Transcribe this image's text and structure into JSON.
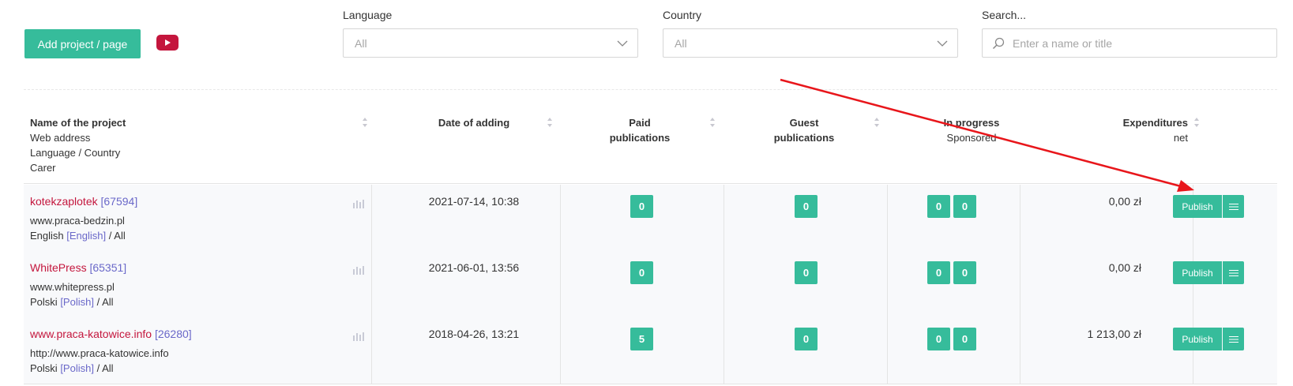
{
  "toolbar": {
    "add_label": "Add project / page",
    "youtube_icon": "youtube-play-icon"
  },
  "filters": {
    "language": {
      "label": "Language",
      "value": "All"
    },
    "country": {
      "label": "Country",
      "value": "All"
    },
    "search": {
      "label": "Search...",
      "placeholder": "Enter a name or title",
      "icon": "search-icon"
    }
  },
  "table": {
    "headers": {
      "name": [
        "Name of the project",
        "Web address",
        "Language / Country",
        "Carer"
      ],
      "date": "Date of adding",
      "paid": [
        "Paid",
        "publications"
      ],
      "guest": [
        "Guest",
        "publications"
      ],
      "progress": [
        "In progress",
        "Sponsored"
      ],
      "expenditures": [
        "Expenditures",
        "net"
      ]
    },
    "rows": [
      {
        "name": "kotekzaplotek",
        "id": "[67594]",
        "address": "www.praca-bedzin.pl",
        "language": "English",
        "language_link": "[English]",
        "country": "/ All",
        "date": "2021-07-14, 10:38",
        "paid": "0",
        "guest": "0",
        "in_progress": "0",
        "sponsored": "0",
        "expenditure": "0,00 zł",
        "publish_label": "Publish"
      },
      {
        "name": "WhitePress",
        "id": "[65351]",
        "address": "www.whitepress.pl",
        "language": "Polski",
        "language_link": "[Polish]",
        "country": "/ All",
        "date": "2021-06-01, 13:56",
        "paid": "0",
        "guest": "0",
        "in_progress": "0",
        "sponsored": "0",
        "expenditure": "0,00 zł",
        "publish_label": "Publish"
      },
      {
        "name": "www.praca-katowice.info",
        "id": "[26280]",
        "address": "http://www.praca-katowice.info",
        "language": "Polski",
        "language_link": "[Polish]",
        "country": "/ All",
        "date": "2018-04-26, 13:21",
        "paid": "5",
        "guest": "0",
        "in_progress": "0",
        "sponsored": "0",
        "expenditure": "1 213,00 zł",
        "publish_label": "Publish"
      }
    ]
  },
  "colors": {
    "accent": "#36bc9b",
    "brand_red": "#c4163d",
    "link_purple": "#6a68c9",
    "annotation_arrow": "#e8161b"
  }
}
